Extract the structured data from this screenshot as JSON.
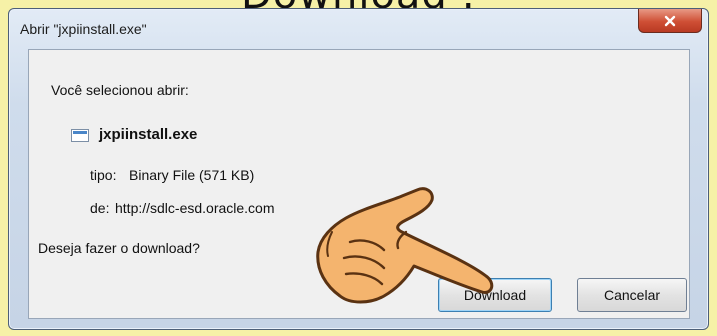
{
  "caption": "Download :",
  "window": {
    "title": "Abrir \"jxpiinstall.exe\"",
    "close_label": "X"
  },
  "dialog": {
    "prompt": "Você selecionou abrir:",
    "file_name": "jxpiinstall.exe",
    "type_label": "tipo:",
    "type_value": "Binary File (571 KB)",
    "source_label": "de:",
    "source_value": "http://sdlc-esd.oracle.com",
    "question": "Deseja fazer o download?"
  },
  "buttons": {
    "download": "Download",
    "cancel": "Cancelar"
  },
  "colors": {
    "background": "#f6f1a7",
    "close_button": "#cf4f35",
    "hand_fill": "#f4b46e"
  },
  "icons": [
    "file-icon",
    "close-icon",
    "pointing-hand-icon"
  ]
}
